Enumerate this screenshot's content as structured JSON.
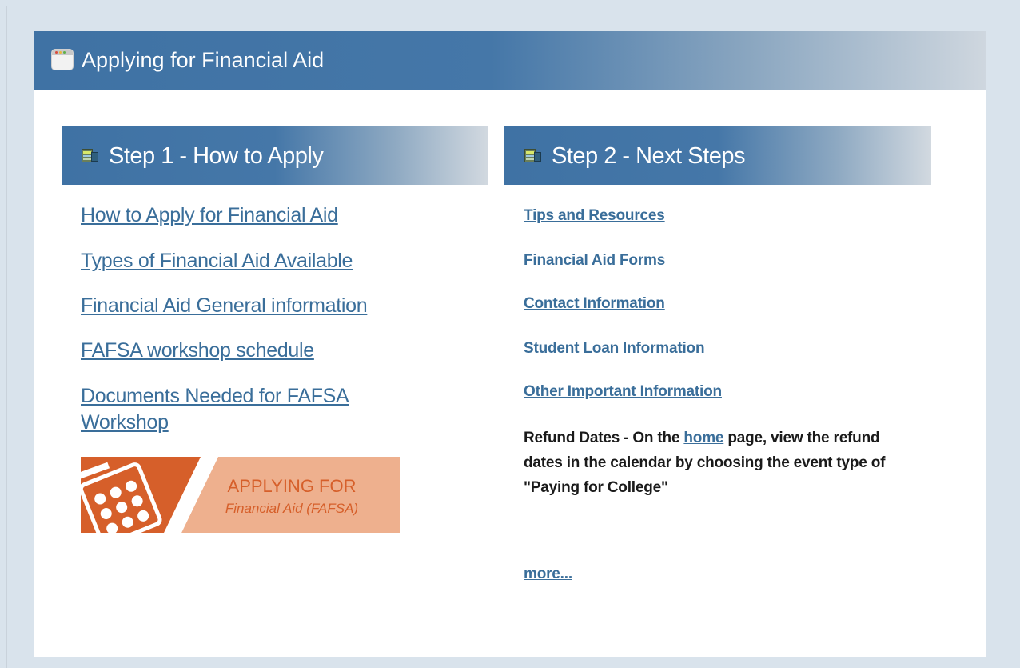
{
  "panel": {
    "title": "Applying for Financial Aid"
  },
  "step1": {
    "title": "Step 1 - How to Apply",
    "links": [
      "How to Apply for Financial Aid",
      "Types of Financial Aid Available",
      "Financial Aid General information",
      "FAFSA workshop schedule",
      "Documents Needed for FAFSA Workshop"
    ],
    "banner": {
      "line1": "APPLYING FOR",
      "line2": "Financial Aid (FAFSA)"
    }
  },
  "step2": {
    "title": "Step 2 - Next Steps",
    "links": [
      "Tips and Resources",
      "Financial Aid Forms",
      "Contact Information",
      "Student Loan Information",
      "Other Important Information"
    ],
    "refund": {
      "prefix": "Refund Dates - On the ",
      "link": "home",
      "suffix": " page, view the refund dates in the calendar by choosing the event type of \"Paying for College\""
    },
    "more": "more..."
  },
  "colors": {
    "header_blue": "#3f72a4",
    "link": "#3a6e9a",
    "banner_orange": "#d65f2a",
    "banner_peach": "#eeb08e",
    "page_bg": "#d9e3ec"
  },
  "icons": [
    "window-icon",
    "step-list-icon",
    "calculator-icon"
  ]
}
